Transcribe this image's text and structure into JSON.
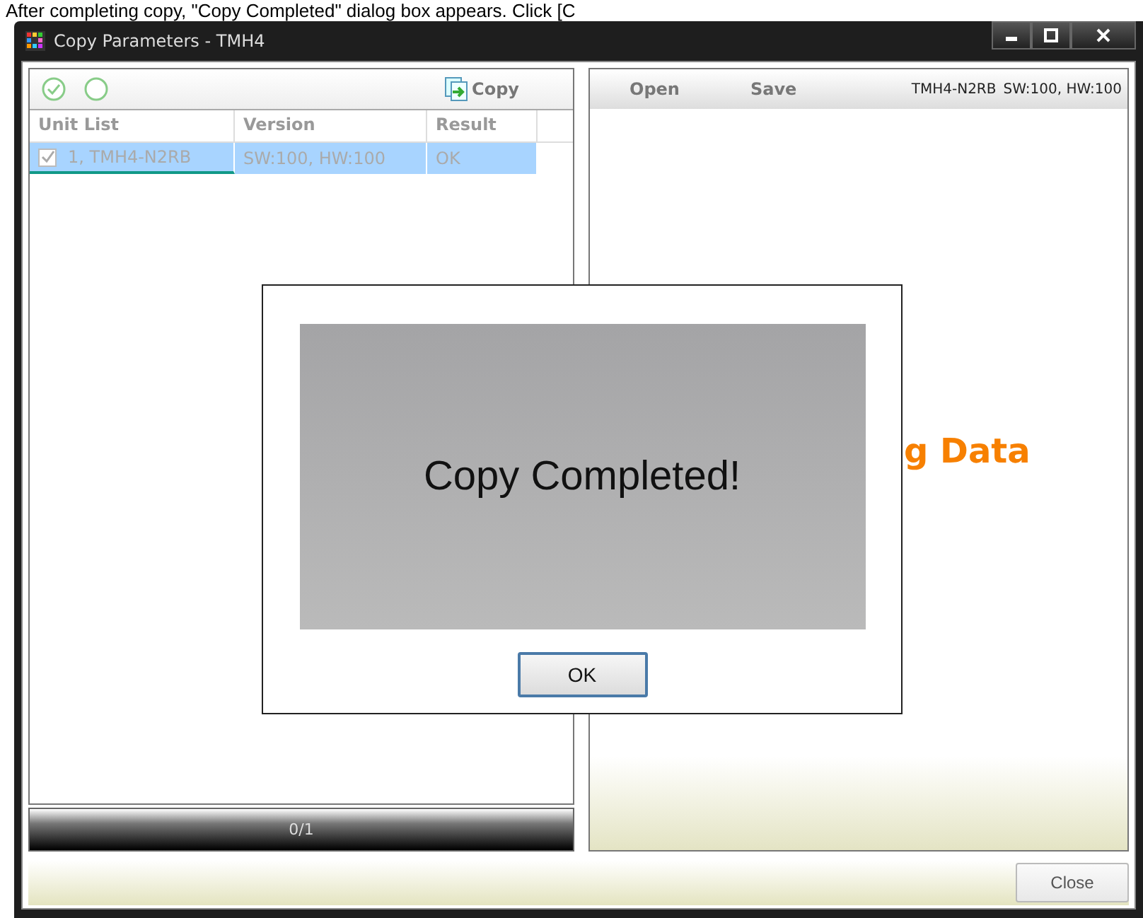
{
  "caption": "After completing copy, \"Copy Completed\" dialog box appears. Click [C",
  "window": {
    "title": "Copy Parameters - TMH4"
  },
  "toolbar": {
    "copy_label": "Copy"
  },
  "unit_table": {
    "columns": [
      "Unit List",
      "Version",
      "Result"
    ],
    "rows": [
      {
        "unit": "1, TMH4-N2RB",
        "version": "SW:100, HW:100",
        "result": "OK",
        "checked": true,
        "selected": true
      }
    ]
  },
  "progress": {
    "text": "0/1",
    "level": 0
  },
  "right_panel": {
    "open_label": "Open",
    "save_label": "Save",
    "device": "TMH4-N2RB",
    "version": "SW:100, HW:100",
    "background_text": "g Data"
  },
  "dialog": {
    "message": "Copy Completed!",
    "ok_label": "OK"
  },
  "close_label": "Close"
}
